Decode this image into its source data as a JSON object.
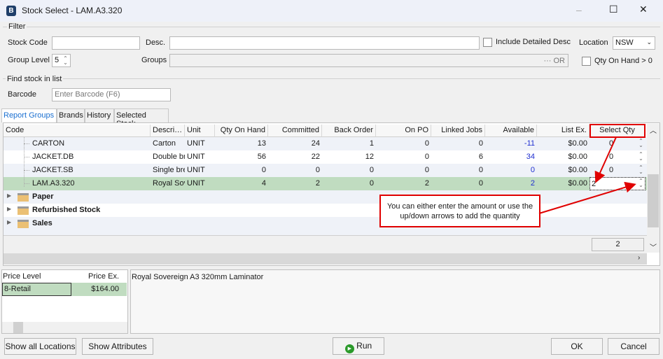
{
  "window": {
    "title": "Stock Select - LAM.A3.320",
    "minimize": "–",
    "maximize": "☐",
    "close": "✕"
  },
  "filter": {
    "group_label": "Filter",
    "stock_code_label": "Stock Code",
    "stock_code_value": "",
    "desc_label": "Desc.",
    "desc_value": "",
    "include_detailed_desc_label": "Include Detailed Desc",
    "include_detailed_desc_checked": false,
    "location_label": "Location",
    "location_value": "NSW",
    "group_level_label": "Group Level",
    "group_level_value": "5",
    "groups_label": "Groups",
    "groups_buttons": "··· OR",
    "qty_on_hand_label": "Qty On Hand > 0",
    "qty_on_hand_checked": false
  },
  "find": {
    "group_label": "Find stock in list",
    "barcode_label": "Barcode",
    "barcode_placeholder": "Enter Barcode (F6)"
  },
  "tabs": [
    {
      "label": "Report Groups",
      "active": true
    },
    {
      "label": "Brands"
    },
    {
      "label": "History"
    },
    {
      "label": "Selected Stock"
    }
  ],
  "grid": {
    "columns": [
      "Code",
      "Descri…",
      "Unit",
      "Qty On Hand",
      "Committed",
      "Back Order",
      "On PO",
      "Linked Jobs",
      "Available",
      "List Ex.",
      "Select Qty"
    ],
    "rows": [
      {
        "code": "CARTON",
        "desc": "Carton",
        "unit": "UNIT",
        "qoh": "13",
        "committed": "24",
        "back_order": "1",
        "on_po": "0",
        "linked_jobs": "0",
        "available": "-11",
        "list_ex": "$0.00",
        "select_qty": "0"
      },
      {
        "code": "JACKET.DB",
        "desc": "Double br",
        "unit": "UNIT",
        "qoh": "56",
        "committed": "22",
        "back_order": "12",
        "on_po": "0",
        "linked_jobs": "6",
        "available": "34",
        "list_ex": "$0.00",
        "select_qty": "0"
      },
      {
        "code": "JACKET.SB",
        "desc": "Single bre",
        "unit": "UNIT",
        "qoh": "0",
        "committed": "0",
        "back_order": "0",
        "on_po": "0",
        "linked_jobs": "0",
        "available": "0",
        "list_ex": "$0.00",
        "select_qty": "0"
      },
      {
        "code": "LAM.A3.320",
        "desc": "Royal Sov",
        "unit": "UNIT",
        "qoh": "4",
        "committed": "2",
        "back_order": "0",
        "on_po": "2",
        "linked_jobs": "0",
        "available": "2",
        "list_ex": "$0.00",
        "select_qty": "2",
        "selected": true
      }
    ],
    "groups": [
      "Paper",
      "Refurbished Stock",
      "Sales"
    ],
    "summary_select_qty": "2"
  },
  "callout": {
    "text": "You can either enter the amount or use the up/down arrows to add the quantity",
    "color": "#e00000"
  },
  "price": {
    "columns": [
      "Price Level",
      "Price Ex."
    ],
    "rows": [
      {
        "level": "8-Retail",
        "price": "$164.00"
      }
    ]
  },
  "description_text": "Royal Sovereign A3 320mm Laminator",
  "buttons": {
    "show_all_locations": "Show all Locations",
    "show_attributes": "Show Attributes",
    "run": "Run",
    "ok": "OK",
    "cancel": "Cancel"
  },
  "colors": {
    "selected_row": "#c0dcc0",
    "alt_row": "#eff2f8",
    "tab_active": "#1a6fd0",
    "available": "#1f2fd0"
  }
}
